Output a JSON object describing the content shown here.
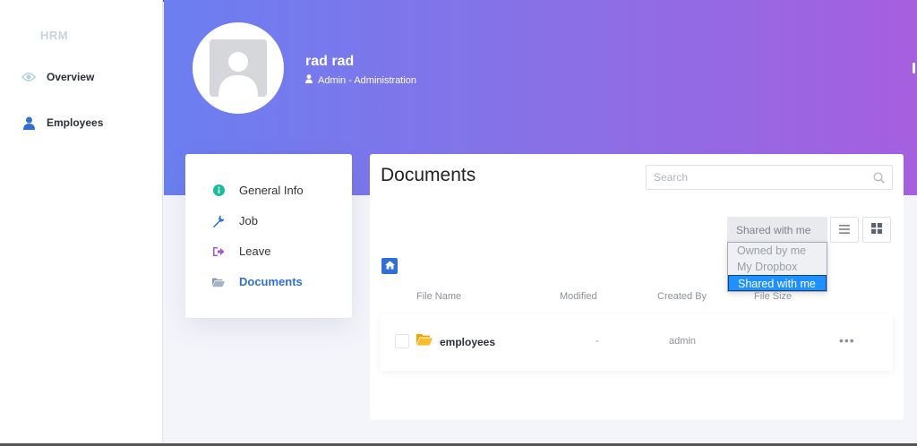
{
  "sidebar": {
    "brand": "HRM",
    "items": [
      {
        "label": "Overview",
        "icon": "eye-icon"
      },
      {
        "label": "Employees",
        "icon": "person-icon"
      }
    ]
  },
  "profile": {
    "name": "rad rad",
    "role": "Admin - Administration"
  },
  "profile_menu": {
    "items": [
      {
        "label": "General Info",
        "icon": "info-circle-icon",
        "color": "#1abc9c"
      },
      {
        "label": "Job",
        "icon": "wrench-icon",
        "color": "#2f6fd6"
      },
      {
        "label": "Leave",
        "icon": "sign-out-icon",
        "color": "#a855c7"
      },
      {
        "label": "Documents",
        "icon": "folder-open-icon",
        "color": "#8a9bb0",
        "active": true
      }
    ]
  },
  "documents": {
    "title": "Documents",
    "search_placeholder": "Search",
    "filter_selected": "Shared with me",
    "filter_options": [
      "Owned by me",
      "My Dropbox",
      "Shared with me"
    ],
    "columns": [
      "File Name",
      "Modified",
      "Created By",
      "File Size"
    ],
    "rows": [
      {
        "name": "employees",
        "modified": "-",
        "created_by": "admin",
        "size": ""
      }
    ],
    "more_label": "•••"
  },
  "colors": {
    "accent": "#2f6fd6",
    "banner_start": "#6b7ff0",
    "banner_end": "#a55fdf",
    "dropdown_selected": "#1e90ff"
  }
}
